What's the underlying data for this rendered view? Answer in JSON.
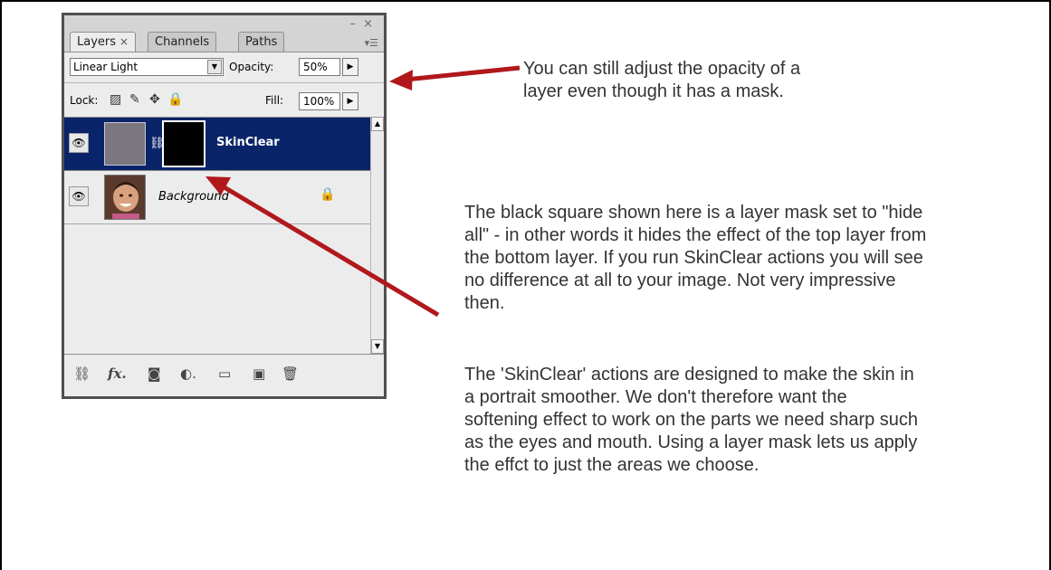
{
  "panel": {
    "tabs": [
      {
        "label": "Layers",
        "close": "×"
      },
      {
        "label": "Channels"
      },
      {
        "label": "Paths"
      }
    ],
    "window_controls": "– ×",
    "blend_mode": "Linear Light",
    "opacity_label": "Opacity:",
    "opacity_value": "50%",
    "lock_label": "Lock:",
    "fill_label": "Fill:",
    "fill_value": "100%",
    "layers": [
      {
        "name": "SkinClear",
        "selected": true,
        "thumb_color": "#7b7781",
        "has_mask": true
      },
      {
        "name": "Background",
        "selected": false,
        "locked": true
      }
    ],
    "bottom_icons": [
      "link-icon",
      "fx-icon",
      "mask-icon",
      "adjustment-icon",
      "folder-icon",
      "new-layer-icon",
      "trash-icon"
    ]
  },
  "annotations": {
    "opacity_note": [
      "You can still adjust the opacity of a",
      "layer even though it has a mask."
    ],
    "mask_note": [
      "The black square shown here is a layer mask set to \"hide",
      "all\" - in other words it hides the effect of the top layer from",
      "the bottom layer. If you run SkinClear actions you will see",
      "no difference at all to your image. Not very impressive",
      "then."
    ],
    "purpose_note": [
      "The 'SkinClear' actions are designed to make the skin in",
      "a portrait smoother. We don't therefore want the",
      "softening effect to work on the parts we need sharp such",
      "as the eyes and mouth. Using a layer mask lets us apply",
      "the effct to just the areas we choose."
    ]
  },
  "colors": {
    "arrow": "#b0181b",
    "selection": "#0a246a"
  }
}
